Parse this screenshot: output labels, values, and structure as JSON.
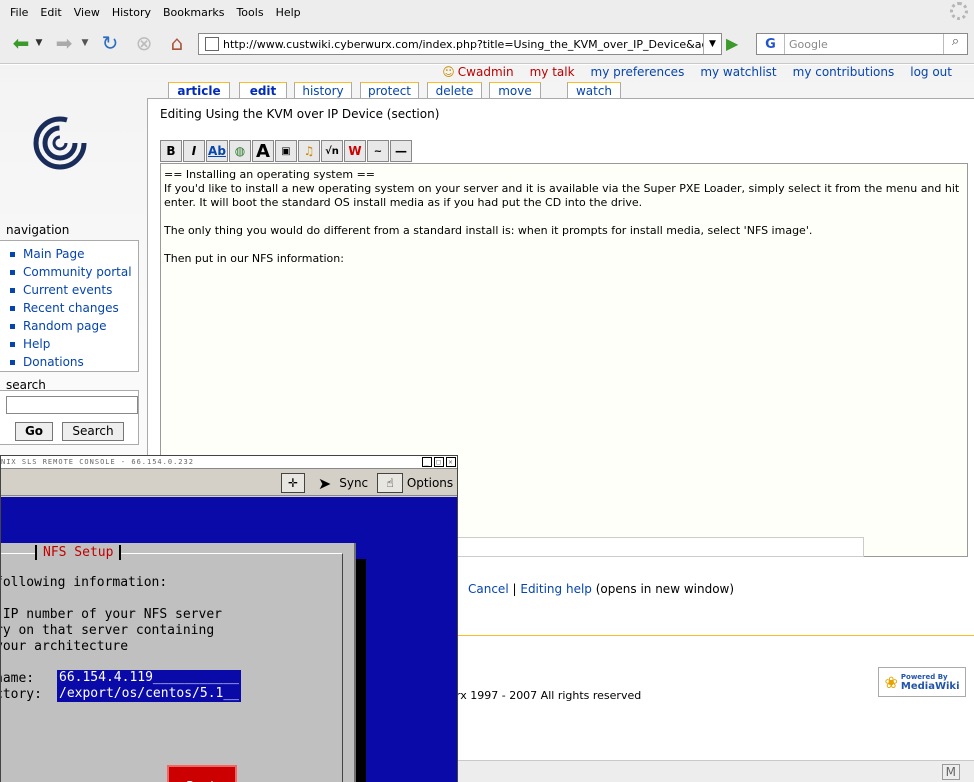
{
  "menubar": {
    "items": [
      "File",
      "Edit",
      "View",
      "History",
      "Bookmarks",
      "Tools",
      "Help"
    ]
  },
  "navbar": {
    "url": "http://www.custwiki.cyberwurx.com/index.php?title=Using_the_KVM_over_IP_Device&action=edit&se",
    "search_placeholder": "Google",
    "search_engine_letter": "G"
  },
  "personal": {
    "user": "Cwadmin",
    "links": [
      "my talk",
      "my preferences",
      "my watchlist",
      "my contributions",
      "log out"
    ]
  },
  "tabs": [
    "article",
    "edit",
    "history",
    "protect",
    "delete",
    "move",
    "watch"
  ],
  "edit_title": "Editing Using the KVM over IP Device (section)",
  "toolbar_buttons": [
    "bold-icon",
    "italic-icon",
    "internal-link-icon",
    "external-link-icon",
    "headline-icon",
    "image-icon",
    "media-icon",
    "math-icon",
    "nowiki-icon",
    "signature-icon",
    "horizontal-line-icon"
  ],
  "textarea": {
    "lines": [
      "== Installing an operating system ==\nIf you'd like to install a new operating system on your server and it is available via the Super PXE Loader, simply select it from the menu and hit enter.  It will boot the standard OS install media as if you had put the CD into the drive.",
      "The only thing you would do different from a standard install is: when it prompts for install media, select 'NFS image'.",
      "Then put in our NFS information:"
    ]
  },
  "edit_actions": {
    "cancel": "Cancel",
    "sep": "|",
    "help": "Editing help",
    "help_note": "(opens in new window)"
  },
  "footer": {
    "copyright": "rx 1997 - 2007 All rights reserved",
    "badge_top": "Powered By",
    "badge_bottom": "MediaWiki"
  },
  "sidebar": {
    "nav_heading": "navigation",
    "nav_items": [
      "Main Page",
      "Community portal",
      "Current events",
      "Recent changes",
      "Random page",
      "Help",
      "Donations"
    ],
    "search_heading": "search",
    "go_label": "Go",
    "search_label": "Search"
  },
  "kvm": {
    "title": "NIX SLS REMOTE CONSOLE - 66.154.0.232",
    "sync_label": "Sync",
    "options_label": "Options",
    "dialog_title": "NFS Setup",
    "line1": "following information:",
    "line2": " IP number of your NFS server",
    "line3": "ry on that server containing",
    "line4": "your architecture",
    "label_name": "name:",
    "value_name": "66.154.4.119___________",
    "label_dir": "ctory:",
    "value_dir": "/export/os/centos/5.1__",
    "back_label": "Back"
  },
  "status": {
    "mail_glyph": "M"
  },
  "colors": {
    "link": "#0645ad",
    "tab_accent": "#fabd23",
    "kvm_screen": "#0a0aa8",
    "kvm_button": "#cc0000"
  }
}
